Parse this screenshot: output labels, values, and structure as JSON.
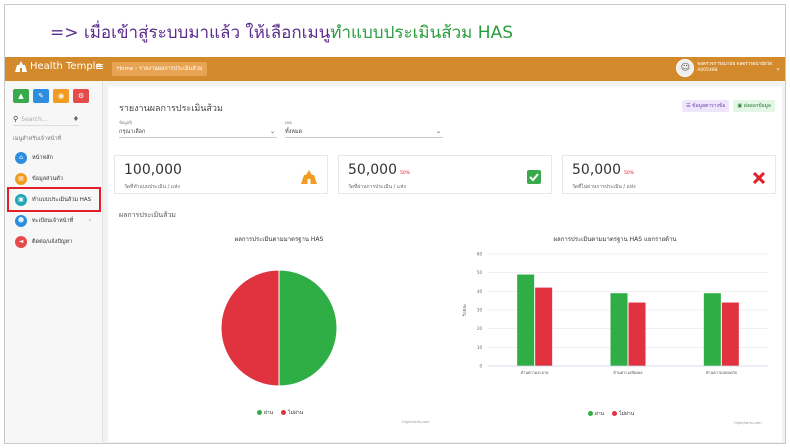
{
  "instruction": {
    "prefix": "=> เมื่อเข้าสู่ระบบมาแล้ว ให้เลือกเมนู",
    "highlight": "ทำแบบประเมินส้วม HAS"
  },
  "header": {
    "brand": "Health Temple",
    "menu_icon": "hamburger-icon",
    "breadcrumb": "Home › รายงานผลการประเมินส้วม",
    "user_name": "พลตรวจการอนามัย พลตรวจอนามัยวัด",
    "user_id": "A005488"
  },
  "sidebar": {
    "tiles": [
      {
        "icon": "chart-icon",
        "color": "#3aa94b"
      },
      {
        "icon": "edit-icon",
        "color": "#2d8ee0"
      },
      {
        "icon": "eye-icon",
        "color": "#f29b21"
      },
      {
        "icon": "settings-icon",
        "color": "#e54b4b"
      }
    ],
    "search_placeholder": "Search...",
    "section_title": "เมนูสำหรับเจ้าหน้าที่",
    "items": [
      {
        "label": "หน้าหลัก",
        "icon": "home-icon",
        "color": "#2d8ee0"
      },
      {
        "label": "ข้อมูลส่วนตัว",
        "icon": "user-card-icon",
        "color": "#f29b21"
      },
      {
        "label": "ทำแบบประเมินส้วม HAS",
        "icon": "clipboard-icon",
        "color": "#23a6b8"
      },
      {
        "label": "ทะเบียนเจ้าหน้าที่",
        "icon": "users-icon",
        "color": "#2d8ee0"
      },
      {
        "label": "ติดต่อ/แจ้งปัญหา",
        "icon": "megaphone-icon",
        "color": "#e54b4b"
      }
    ]
  },
  "main": {
    "title": "รายงานผลการประเมินส้วม",
    "button_data": "ข้อมูลตารางข้อ",
    "button_export": "ส่งออกข้อมูล",
    "filter1_label": "ข้อมูลปี",
    "filter1_value": "กรุณาเลือก",
    "filter2_label": "เขต",
    "filter2_value": "ทั้งหมด",
    "stats": [
      {
        "value": "100,000",
        "pct": "",
        "label": "วัดที่ทำแบบประเมิน / แห่ง",
        "icon": "temple-icon",
        "color": "#f29b21"
      },
      {
        "value": "50,000",
        "pct": "50%",
        "label": "วัดที่ผ่านการประเมิน / แห่ง",
        "icon": "check-icon",
        "color": "#3aa94b"
      },
      {
        "value": "50,000",
        "pct": "50%",
        "label": "วัดที่ไม่ผ่านการประเมิน / แห่ง",
        "icon": "x-icon",
        "color": "#e0202a"
      }
    ],
    "section_title": "ผลการประเมินส้วม",
    "credit": "Highcharts.com"
  },
  "chart_data": [
    {
      "type": "pie",
      "title": "ผลการประเมินตามมาตรฐาน HAS",
      "categories": [
        "ผ่าน",
        "ไม่ผ่าน"
      ],
      "values": [
        50,
        50
      ],
      "colors": [
        "#2fae45",
        "#e0323f"
      ],
      "legend": "bottom"
    },
    {
      "type": "bar",
      "title": "ผลการประเมินตามมาตรฐาน HAS แยกรายด้าน",
      "categories": [
        "ด้านความสะอาด",
        "ด้านความเพียงพอ",
        "ด้านความปลอดภัย"
      ],
      "series": [
        {
          "name": "ผ่าน",
          "values": [
            49,
            39,
            39
          ],
          "color": "#2fae45"
        },
        {
          "name": "ไม่ผ่าน",
          "values": [
            42,
            34,
            34
          ],
          "color": "#e0323f"
        }
      ],
      "ylabel": "ร้อยละ",
      "ylim": [
        0,
        60
      ],
      "yticks": [
        0,
        10,
        20,
        30,
        40,
        50,
        60
      ],
      "grid": true,
      "legend": "bottom"
    }
  ]
}
